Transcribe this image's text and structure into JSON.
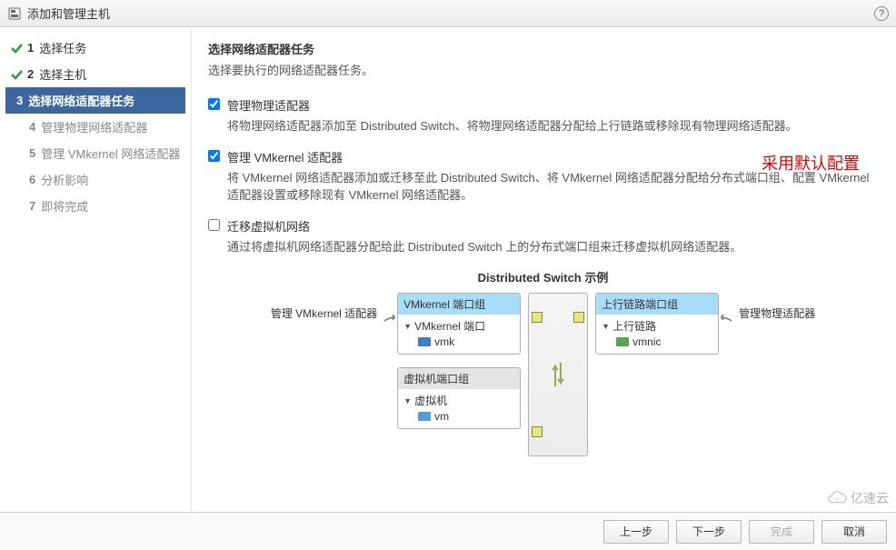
{
  "window": {
    "title": "添加和管理主机"
  },
  "sidebar": {
    "steps": [
      {
        "num": "1",
        "label": "选择任务"
      },
      {
        "num": "2",
        "label": "选择主机"
      },
      {
        "num": "3",
        "label": "选择网络适配器任务"
      },
      {
        "num": "4",
        "label": "管理物理网络适配器"
      },
      {
        "num": "5",
        "label": "管理 VMkernel 网络适配器"
      },
      {
        "num": "6",
        "label": "分析影响"
      },
      {
        "num": "7",
        "label": "即将完成"
      }
    ]
  },
  "main": {
    "heading": "选择网络适配器任务",
    "subheading": "选择要执行的网络适配器任务。",
    "options": [
      {
        "checked": true,
        "label": "管理物理适配器",
        "desc": "将物理网络适配器添加至 Distributed Switch、将物理网络适配器分配给上行链路或移除现有物理网络适配器。"
      },
      {
        "checked": true,
        "label": "管理 VMkernel 适配器",
        "desc": "将 VMkernel 网络适配器添加或迁移至此 Distributed Switch、将 VMkernel 网络适配器分配给分布式端口组、配置 VMkernel 适配器设置或移除现有 VMkernel 网络适配器。"
      },
      {
        "checked": false,
        "label": "迁移虚拟机网络",
        "desc": "通过将虚拟机网络适配器分配给此 Distributed Switch 上的分布式端口组来迁移虚拟机网络适配器。"
      }
    ],
    "annotation": "采用默认配置",
    "diagram": {
      "title": "Distributed Switch 示例",
      "left_label": "管理 VMkernel 适配器",
      "right_label": "管理物理适配器",
      "vmk_group": {
        "header": "VMkernel 端口组",
        "row1": "VMkernel 端口",
        "row2": "vmk"
      },
      "vm_group": {
        "header": "虚拟机端口组",
        "row1": "虚拟机",
        "row2": "vm"
      },
      "uplink_group": {
        "header": "上行链路端口组",
        "row1": "上行链路",
        "row2": "vmnic"
      }
    }
  },
  "footer": {
    "back": "上一步",
    "next": "下一步",
    "finish": "完成",
    "cancel": "取消"
  },
  "watermark": "亿速云"
}
